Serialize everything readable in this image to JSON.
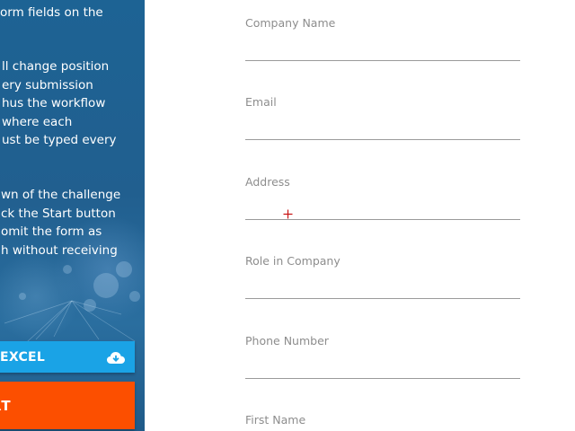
{
  "instructions": {
    "para1": [
      "orm fields on the"
    ],
    "para2": [
      "ll change position",
      "ery submission",
      "hus the workflow",
      " where each",
      "ust be typed every"
    ],
    "para3": [
      "wn of the challenge",
      "ck the Start button",
      "omit the form as",
      "h without receiving"
    ]
  },
  "buttons": {
    "excel_label": "EXCEL",
    "excel_icon": "cloud-download-icon",
    "start_label": "RT"
  },
  "colors": {
    "panel": "#215f8f",
    "excel_button": "#1aa3e6",
    "start_button": "#fc4f00"
  },
  "form": {
    "fields": [
      {
        "label": "Company Name",
        "value": ""
      },
      {
        "label": "Email",
        "value": ""
      },
      {
        "label": "Address",
        "value": ""
      },
      {
        "label": "Role in Company",
        "value": ""
      },
      {
        "label": "Phone Number",
        "value": ""
      },
      {
        "label": "First Name",
        "value": ""
      }
    ]
  }
}
